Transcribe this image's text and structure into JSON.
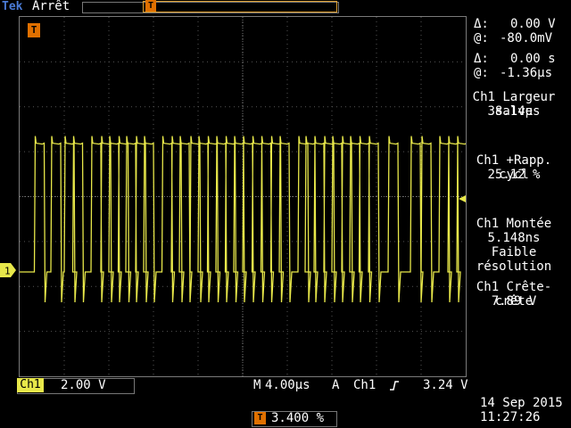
{
  "header": {
    "brand": "Tek",
    "run_state": "Arrêt",
    "record_trigger_glyph": "T",
    "trigger_position_glyph": "T"
  },
  "channel": {
    "marker_label": "1",
    "color": "#e8e84a",
    "tag": "Ch1",
    "scale": "2.00 V"
  },
  "cursors": {
    "delta_v_label": "Δ:",
    "delta_v_value": "0.00 V",
    "at_v_label": "@:",
    "at_v_value": "-80.0mV",
    "delta_t_label": "Δ:",
    "delta_t_value": "0.00 s",
    "at_t_label": "@:",
    "at_t_value": "-1.36µs"
  },
  "measurements": [
    {
      "head": "Ch1 Largeur salve",
      "value": "38.14µs"
    },
    {
      "head": "Ch1 +Rapp. cycl",
      "value": "25.12 %"
    },
    {
      "head": "Ch1 Montée",
      "value": "5.148ns",
      "note1": "Faible",
      "note2": "résolution"
    },
    {
      "head": "Ch1 Crête-crête",
      "value": "7.89 V"
    }
  ],
  "horizontal": {
    "mode": "M",
    "timebase": "4.00µs",
    "trig_label": "A",
    "trig_source": "Ch1",
    "trig_slope_icon": "rising-edge-icon",
    "trig_level": "3.24 V"
  },
  "trigger_position": {
    "glyph": "T",
    "value": "3.400 %"
  },
  "timestamp": {
    "date": "14 Sep  2015",
    "time": "11:27:26"
  },
  "waveform": {
    "pulse_times_div": [
      0.35,
      0.72,
      1.02,
      1.21,
      1.62,
      1.84,
      2.02,
      2.23,
      2.4,
      2.62,
      2.8,
      3.21,
      3.42,
      3.6,
      3.84,
      4.02,
      4.23,
      4.42,
      4.63,
      4.82,
      5.02,
      5.23,
      5.43,
      5.65,
      5.84,
      6.26,
      6.42,
      6.62,
      6.84,
      7.02,
      7.24,
      7.42,
      7.63,
      7.84,
      8.28,
      8.78,
      9.02,
      9.42,
      9.62,
      9.82
    ],
    "high_level_div": 3.05,
    "low_level_div": 0.0
  }
}
